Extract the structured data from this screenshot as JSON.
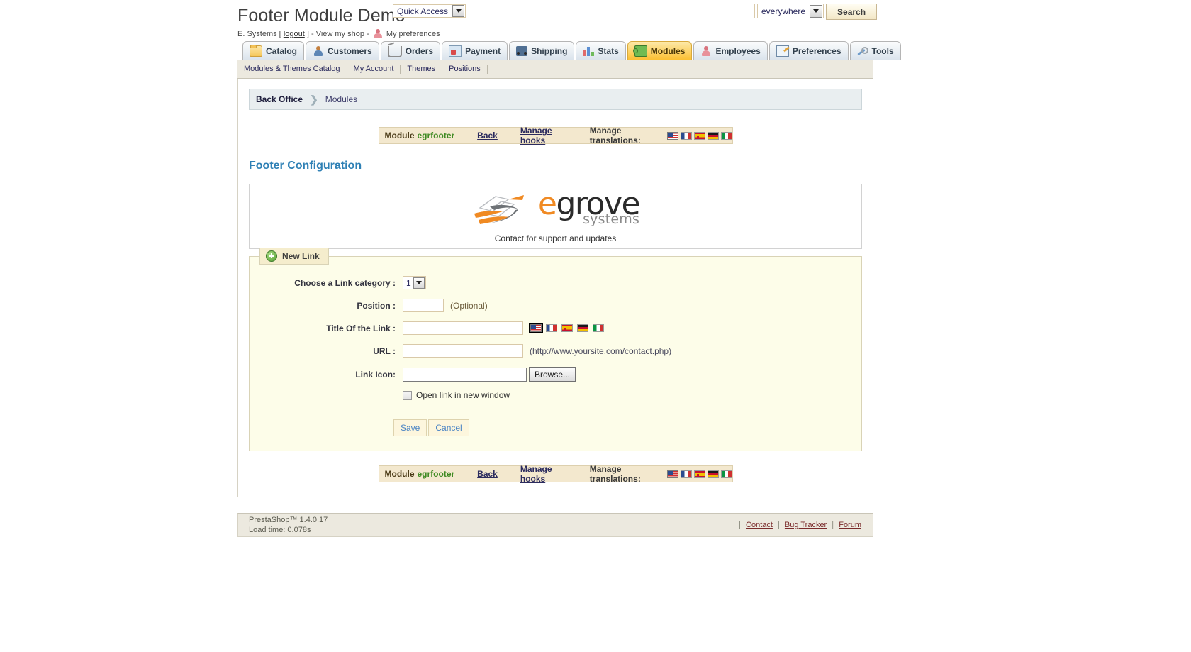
{
  "header": {
    "title": "Footer Module Demo",
    "user": "E. Systems [",
    "logout": "logout",
    "after_logout": "] - View my shop -",
    "preferences": "My preferences",
    "quick_access": "Quick Access",
    "search_value": "",
    "search_placeholder": "",
    "search_scope": "everywhere",
    "search_button": "Search"
  },
  "tabs": [
    {
      "label": "Catalog",
      "icon": "folder-icon",
      "active": false
    },
    {
      "label": "Customers",
      "icon": "customers-icon",
      "active": false
    },
    {
      "label": "Orders",
      "icon": "cart-icon",
      "active": false
    },
    {
      "label": "Payment",
      "icon": "payment-icon",
      "active": false
    },
    {
      "label": "Shipping",
      "icon": "truck-icon",
      "active": false
    },
    {
      "label": "Stats",
      "icon": "chart-icon",
      "active": false
    },
    {
      "label": "Modules",
      "icon": "puzzle-icon",
      "active": true
    },
    {
      "label": "Employees",
      "icon": "employee-icon",
      "active": false
    },
    {
      "label": "Preferences",
      "icon": "preferences-icon",
      "active": false
    },
    {
      "label": "Tools",
      "icon": "wrench-icon",
      "active": false
    }
  ],
  "subtabs": [
    {
      "label": "Modules & Themes Catalog"
    },
    {
      "label": "My Account"
    },
    {
      "label": "Themes"
    },
    {
      "label": "Positions"
    }
  ],
  "breadcrumb": {
    "root": "Back Office",
    "chevron": "❯",
    "current": "Modules"
  },
  "module_bar": {
    "module_label": "Module",
    "module_name": "egrfooter",
    "back": "Back",
    "manage_hooks": "Manage hooks",
    "translations_label": "Manage translations:",
    "flags": [
      "us-flag-icon",
      "fr-flag-icon",
      "es-flag-icon",
      "de-flag-icon",
      "it-flag-icon"
    ]
  },
  "config": {
    "title": "Footer Configuration",
    "logo_orange": "e",
    "logo_dark": "grove",
    "logo_sub": "systems",
    "logo_caption": "Contact for support and updates"
  },
  "form": {
    "legend": "New Link",
    "category_label": "Choose a Link category :",
    "category_value": "1",
    "position_label": "Position :",
    "position_value": "",
    "position_hint": "(Optional)",
    "title_label": "Title Of the Link :",
    "title_value": "",
    "url_label": "URL :",
    "url_value": "",
    "url_hint": "(http://www.yoursite.com/contact.php)",
    "icon_label": "Link Icon:",
    "icon_value": "",
    "browse": "Browse...",
    "checkbox_label": "Open link in new window",
    "checkbox_checked": false,
    "save": "Save",
    "cancel": "Cancel"
  },
  "footer": {
    "version": "PrestaShop™ 1.4.0.17",
    "load_time": "Load time: 0.078s",
    "contact": "Contact",
    "bug_tracker": "Bug Tracker",
    "forum": "Forum",
    "separator": "|"
  },
  "colors": {
    "accent_orange": "#f08a23",
    "active_tab": "#fbc034",
    "heading_blue": "#2e80b5",
    "module_green": "#3f8a22"
  }
}
